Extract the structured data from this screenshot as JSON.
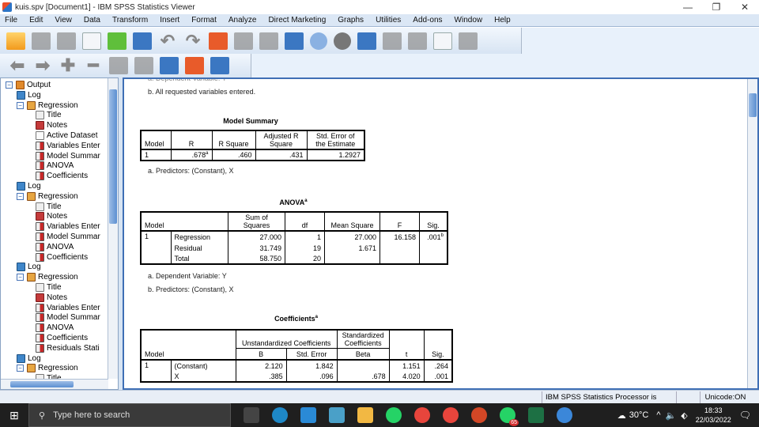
{
  "window": {
    "title": "kuis.spv [Document1] - IBM SPSS Statistics Viewer",
    "controls": {
      "minimize": "—",
      "restore": "❐",
      "close": "✕"
    }
  },
  "menu": [
    "File",
    "Edit",
    "View",
    "Data",
    "Transform",
    "Insert",
    "Format",
    "Analyze",
    "Direct Marketing",
    "Graphs",
    "Utilities",
    "Add-ons",
    "Window",
    "Help"
  ],
  "toolbar1": [
    "open-folder-icon",
    "save-icon",
    "print-icon",
    "print-preview-icon",
    "export-icon",
    "recall-dialog-icon",
    "undo-icon",
    "redo-icon",
    "goto-data-icon",
    "goto-case-icon",
    "goto-variable-icon",
    "variables-icon",
    "use-sets-icon",
    "show-all-variables-icon",
    "spell-check-icon",
    "designate-window-icon",
    "promote-icon",
    "demote-icon",
    "run-script-icon",
    "hide-icon"
  ],
  "toolbar2": [
    "back-icon",
    "forward-icon",
    "expand-icon",
    "collapse-icon",
    "show-icon",
    "hide-icon",
    "insert-heading-icon",
    "insert-title-icon",
    "insert-text-icon"
  ],
  "outline": [
    {
      "label": "Output",
      "icon": "output",
      "level": 0,
      "expander": "−"
    },
    {
      "label": "Log",
      "icon": "log",
      "level": 1
    },
    {
      "label": "Regression",
      "icon": "reg",
      "level": 1,
      "expander": "−"
    },
    {
      "label": "Title",
      "icon": "title",
      "level": 2
    },
    {
      "label": "Notes",
      "icon": "notes",
      "level": 2
    },
    {
      "label": "Active Dataset",
      "icon": "page",
      "level": 2
    },
    {
      "label": "Variables Enter",
      "icon": "tbl",
      "level": 2
    },
    {
      "label": "Model Summar",
      "icon": "tbl",
      "level": 2
    },
    {
      "label": "ANOVA",
      "icon": "tbl",
      "level": 2
    },
    {
      "label": "Coefficients",
      "icon": "tbl",
      "level": 2
    },
    {
      "label": "Log",
      "icon": "log",
      "level": 1
    },
    {
      "label": "Regression",
      "icon": "reg",
      "level": 1,
      "expander": "−"
    },
    {
      "label": "Title",
      "icon": "title",
      "level": 2
    },
    {
      "label": "Notes",
      "icon": "notes",
      "level": 2
    },
    {
      "label": "Variables Enter",
      "icon": "tbl",
      "level": 2
    },
    {
      "label": "Model Summar",
      "icon": "tbl",
      "level": 2
    },
    {
      "label": "ANOVA",
      "icon": "tbl",
      "level": 2
    },
    {
      "label": "Coefficients",
      "icon": "tbl",
      "level": 2
    },
    {
      "label": "Log",
      "icon": "log",
      "level": 1
    },
    {
      "label": "Regression",
      "icon": "reg",
      "level": 1,
      "expander": "−"
    },
    {
      "label": "Title",
      "icon": "title",
      "level": 2
    },
    {
      "label": "Notes",
      "icon": "notes",
      "level": 2
    },
    {
      "label": "Variables Enter",
      "icon": "tbl",
      "level": 2
    },
    {
      "label": "Model Summar",
      "icon": "tbl",
      "level": 2
    },
    {
      "label": "ANOVA",
      "icon": "tbl",
      "level": 2
    },
    {
      "label": "Coefficients",
      "icon": "tbl",
      "level": 2
    },
    {
      "label": "Residuals Stati",
      "icon": "tbl",
      "level": 2
    },
    {
      "label": "Log",
      "icon": "log",
      "level": 1
    },
    {
      "label": "Regression",
      "icon": "reg",
      "level": 1,
      "expander": "−"
    },
    {
      "label": "Title",
      "icon": "title",
      "level": 2
    }
  ],
  "viewer": {
    "cut_note": "a. Dependent Variable: Y",
    "note_b_entered": "b. All requested variables entered.",
    "model_summary": {
      "title": "Model Summary",
      "headers": [
        "Model",
        "R",
        "R Square",
        "Adjusted R Square",
        "Std. Error of the Estimate"
      ],
      "row": {
        "model": "1",
        "r": ".678",
        "r_sup": "a",
        "r_square": ".460",
        "adj_r_square": ".431",
        "std_error": "1.2927"
      },
      "footnote": "a. Predictors: (Constant), X"
    },
    "anova": {
      "title": "ANOVA",
      "title_sup": "a",
      "headers": [
        "Model",
        "Sum of Squares",
        "df",
        "Mean Square",
        "F",
        "Sig."
      ],
      "model": "1",
      "rows": [
        {
          "label": "Regression",
          "ss": "27.000",
          "df": "1",
          "ms": "27.000",
          "f": "16.158",
          "sig": ".001",
          "sig_sup": "b"
        },
        {
          "label": "Residual",
          "ss": "31.749",
          "df": "19",
          "ms": "1.671",
          "f": "",
          "sig": "",
          "sig_sup": ""
        },
        {
          "label": "Total",
          "ss": "58.750",
          "df": "20",
          "ms": "",
          "f": "",
          "sig": "",
          "sig_sup": ""
        }
      ],
      "footnotes": [
        "a. Dependent Variable: Y",
        "b. Predictors: (Constant), X"
      ]
    },
    "coefficients": {
      "title": "Coefficients",
      "title_sup": "a",
      "group_unstd": "Unstandardized Coefficients",
      "group_std": "Standardized Coefficients",
      "headers": [
        "Model",
        "B",
        "Std. Error",
        "Beta",
        "t",
        "Sig."
      ],
      "model": "1",
      "rows": [
        {
          "label": "(Constant)",
          "b": "2.120",
          "se": "1.842",
          "beta": "",
          "t": "1.151",
          "sig": ".264"
        },
        {
          "label": "X",
          "b": ".385",
          "se": ".096",
          "beta": ".678",
          "t": "4.020",
          "sig": ".001"
        }
      ]
    }
  },
  "status": {
    "processor": "IBM SPSS Statistics Processor is ready",
    "unicode": "Unicode:ON"
  },
  "taskbar": {
    "search_placeholder": "Type here to search",
    "apps": [
      "task-view-icon",
      "edge-icon",
      "mail-icon",
      "stock-app-icon",
      "file-explorer-icon",
      "whatsapp-icon",
      "chrome-icon",
      "chrome-profile-icon",
      "powerpoint-icon",
      "whatsapp-business-icon",
      "excel-icon",
      "spss-icon"
    ],
    "badge": "65",
    "weather": "30°C",
    "time": "18:33",
    "date": "22/03/2022",
    "notifications": "1"
  }
}
